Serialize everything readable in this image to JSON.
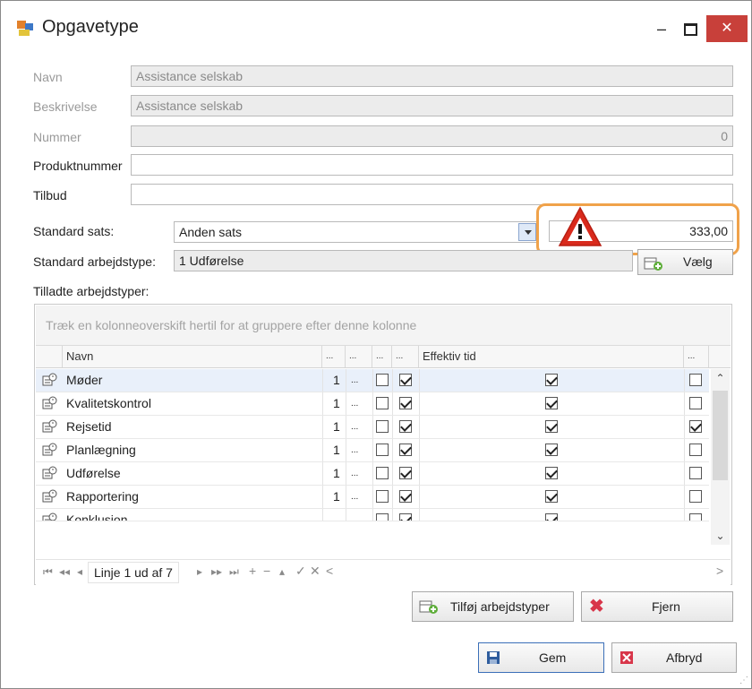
{
  "window": {
    "title": "Opgavetype",
    "minimize_glyph": "–",
    "close_glyph": "✕"
  },
  "form": {
    "navn_label": "Navn",
    "navn_value": "Assistance selskab",
    "beskrivelse_label": "Beskrivelse",
    "beskrivelse_value": "Assistance selskab",
    "nummer_label": "Nummer",
    "nummer_value": "0",
    "produktnummer_label": "Produktnummer",
    "produktnummer_value": "",
    "tilbud_label": "Tilbud",
    "tilbud_value": "",
    "standard_sats_label": "Standard sats:",
    "standard_sats_value": "Anden sats",
    "sats_amount": "333,00",
    "standard_arbejdstype_label": "Standard arbejdstype:",
    "standard_arbejdstype_value": "1 Udførelse",
    "vaelg_label": "Vælg",
    "tilladte_label": "Tilladte arbejdstyper:"
  },
  "colors": {
    "warning_frame": "#f0a24a",
    "warning_triangle": "#d92a1c",
    "close_button": "#c8403a",
    "selected_row": "#e9f0fa"
  },
  "grid": {
    "group_panel_text": "Træk en kolonneoverskift hertil for at gruppere efter denne kolonne",
    "headers": {
      "navn": "Navn",
      "c1": "...",
      "c2": "...",
      "c3": "...",
      "c4": "...",
      "effektiv": "Effektiv tid",
      "c5": "..."
    },
    "rows": [
      {
        "navn": "Møder",
        "num": "1",
        "dots": "...",
        "cb1": false,
        "cb2": true,
        "effektiv": true,
        "last": false
      },
      {
        "navn": "Kvalitetskontrol",
        "num": "1",
        "dots": "...",
        "cb1": false,
        "cb2": true,
        "effektiv": true,
        "last": false
      },
      {
        "navn": "Rejsetid",
        "num": "1",
        "dots": "...",
        "cb1": false,
        "cb2": true,
        "effektiv": true,
        "last": true
      },
      {
        "navn": "Planlægning",
        "num": "1",
        "dots": "...",
        "cb1": false,
        "cb2": true,
        "effektiv": true,
        "last": false
      },
      {
        "navn": "Udførelse",
        "num": "1",
        "dots": "...",
        "cb1": false,
        "cb2": true,
        "effektiv": true,
        "last": false
      },
      {
        "navn": "Rapportering",
        "num": "1",
        "dots": "...",
        "cb1": false,
        "cb2": true,
        "effektiv": true,
        "last": false
      },
      {
        "navn": "Konklusion",
        "num": "",
        "dots": "",
        "cb1": false,
        "cb2": true,
        "effektiv": true,
        "last": false
      }
    ],
    "pager_text": "Linje 1 ud af 7",
    "nav_first": "⏮",
    "nav_prev_page": "◂◂",
    "nav_prev": "◂",
    "nav_next": "▸",
    "nav_next_page": "▸▸",
    "nav_last": "⏭",
    "nav_add": "+",
    "nav_remove": "−",
    "nav_up": "▴",
    "nav_check": "✓",
    "nav_cancel": "✕",
    "nav_scroll_left": "<",
    "nav_scroll_right": ">",
    "scroll_up": "⌃",
    "scroll_down": "⌄"
  },
  "buttons": {
    "tilfoej": "Tilføj arbejdstyper",
    "fjern": "Fjern",
    "gem": "Gem",
    "afbryd": "Afbryd"
  }
}
